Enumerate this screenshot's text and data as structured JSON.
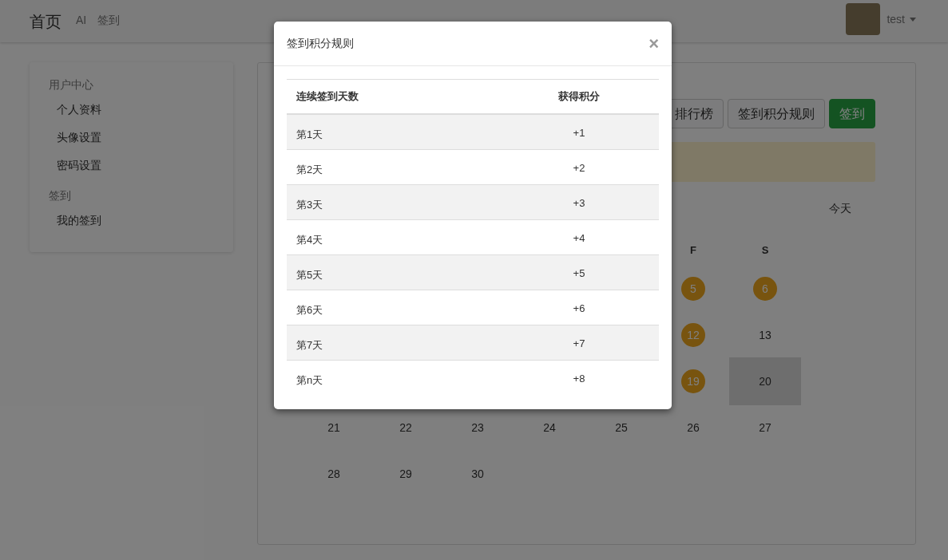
{
  "navbar": {
    "brand": "首页",
    "links": [
      {
        "label": "AI"
      },
      {
        "label": "签到"
      }
    ],
    "user": {
      "name": "test"
    }
  },
  "sidebar": {
    "sections": [
      {
        "heading": "用户中心",
        "items": [
          {
            "label": "个人资料"
          },
          {
            "label": "头像设置"
          },
          {
            "label": "密码设置"
          }
        ]
      },
      {
        "heading": "签到",
        "items": [
          {
            "label": "我的签到"
          }
        ]
      }
    ]
  },
  "toolbar": {
    "buttons": [
      {
        "label": "排行榜",
        "kind": "default"
      },
      {
        "label": "签到积分规则",
        "kind": "default"
      },
      {
        "label": "签到",
        "kind": "primary"
      }
    ]
  },
  "calendar": {
    "today_button": "今天",
    "weekdays": [
      "F",
      "S"
    ],
    "weeks": [
      [
        {
          "day": "5",
          "signed": true,
          "today": false
        },
        {
          "day": "6",
          "signed": true,
          "today": false
        }
      ],
      [
        {
          "day": "12",
          "signed": true,
          "today": false
        },
        {
          "day": "13",
          "signed": false,
          "today": false
        }
      ],
      [
        {
          "day": "19",
          "signed": true,
          "today": false
        },
        {
          "day": "20",
          "signed": false,
          "today": true
        }
      ],
      [
        {
          "day": "21",
          "signed": false,
          "today": false
        },
        {
          "day": "22",
          "signed": false,
          "today": false
        },
        {
          "day": "23",
          "signed": false,
          "today": false
        },
        {
          "day": "24",
          "signed": false,
          "today": false
        },
        {
          "day": "25",
          "signed": false,
          "today": false
        },
        {
          "day": "26",
          "signed": false,
          "today": false
        },
        {
          "day": "27",
          "signed": false,
          "today": false
        }
      ],
      [
        {
          "day": "28",
          "signed": false,
          "today": false
        },
        {
          "day": "29",
          "signed": false,
          "today": false
        },
        {
          "day": "30",
          "signed": false,
          "today": false
        }
      ]
    ]
  },
  "modal": {
    "title": "签到积分规则",
    "close": "×",
    "columns": [
      "连续签到天数",
      "获得积分"
    ],
    "rows": [
      {
        "days": "第1天",
        "points": "+1"
      },
      {
        "days": "第2天",
        "points": "+2"
      },
      {
        "days": "第3天",
        "points": "+3"
      },
      {
        "days": "第4天",
        "points": "+4"
      },
      {
        "days": "第5天",
        "points": "+5"
      },
      {
        "days": "第6天",
        "points": "+6"
      },
      {
        "days": "第7天",
        "points": "+7"
      },
      {
        "days": "第n天",
        "points": "+8"
      }
    ]
  }
}
